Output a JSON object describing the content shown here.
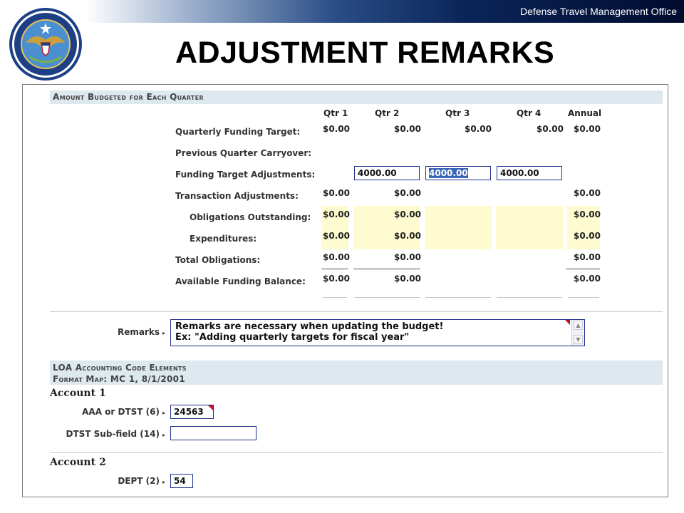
{
  "header": {
    "office": "Defense Travel Management Office",
    "title": "ADJUSTMENT REMARKS",
    "seal_top_text": "Defense Travel Management Office",
    "seal_bottom_text": "Department of Defense"
  },
  "budget": {
    "section_title": "Amount Budgeted for Each Quarter",
    "columns": [
      "Qtr 1",
      "Qtr 2",
      "Qtr 3",
      "Qtr 4",
      "Annual"
    ],
    "rows": {
      "quarterly_funding_target": {
        "label": "Quarterly Funding Target:",
        "values": [
          "$0.00",
          "$0.00",
          "$0.00",
          "$0.00",
          "$0.00"
        ]
      },
      "previous_quarter_carryover": {
        "label": "Previous Quarter Carryover:"
      },
      "funding_target_adjustments": {
        "label": "Funding Target Adjustments:",
        "inputs": [
          "4000.00",
          "4000.00",
          "4000.00"
        ]
      },
      "transaction_adjustments": {
        "label": "Transaction Adjustments:",
        "values": [
          "$0.00",
          "$0.00",
          "$0.00"
        ]
      },
      "obligations_outstanding": {
        "label": "Obligations Outstanding:",
        "values": [
          "$0.00",
          "$0.00",
          "$0.00"
        ]
      },
      "expenditures": {
        "label": "Expenditures:",
        "values": [
          "$0.00",
          "$0.00",
          "$0.00"
        ]
      },
      "total_obligations": {
        "label": "Total Obligations:",
        "values": [
          "$0.00",
          "$0.00",
          "$0.00"
        ]
      },
      "available_funding_balance": {
        "label": "Available Funding Balance:",
        "values": [
          "$0.00",
          "$0.00",
          "$0.00"
        ]
      }
    }
  },
  "remarks": {
    "label": "Remarks",
    "line1": "Remarks are necessary when updating the budget!",
    "line2": "Ex: \"Adding quarterly targets for fiscal year\""
  },
  "loa": {
    "section_title": "LOA Accounting Code Elements",
    "format_map": "Format Map: MC 1, 8/1/2001",
    "account1": {
      "title": "Account 1",
      "aaa_label": "AAA or DTST (6)",
      "aaa_value": "24563",
      "subfield_label": "DTST Sub-field (14)",
      "subfield_value": ""
    },
    "account2": {
      "title": "Account 2",
      "dept_label": "DEPT (2)",
      "dept_value": "54"
    }
  },
  "colors": {
    "accent": "#1f2f8c",
    "highlight": "#fdfbcf",
    "section_bg": "#dde8ef",
    "required_marker": "#c0122c"
  }
}
